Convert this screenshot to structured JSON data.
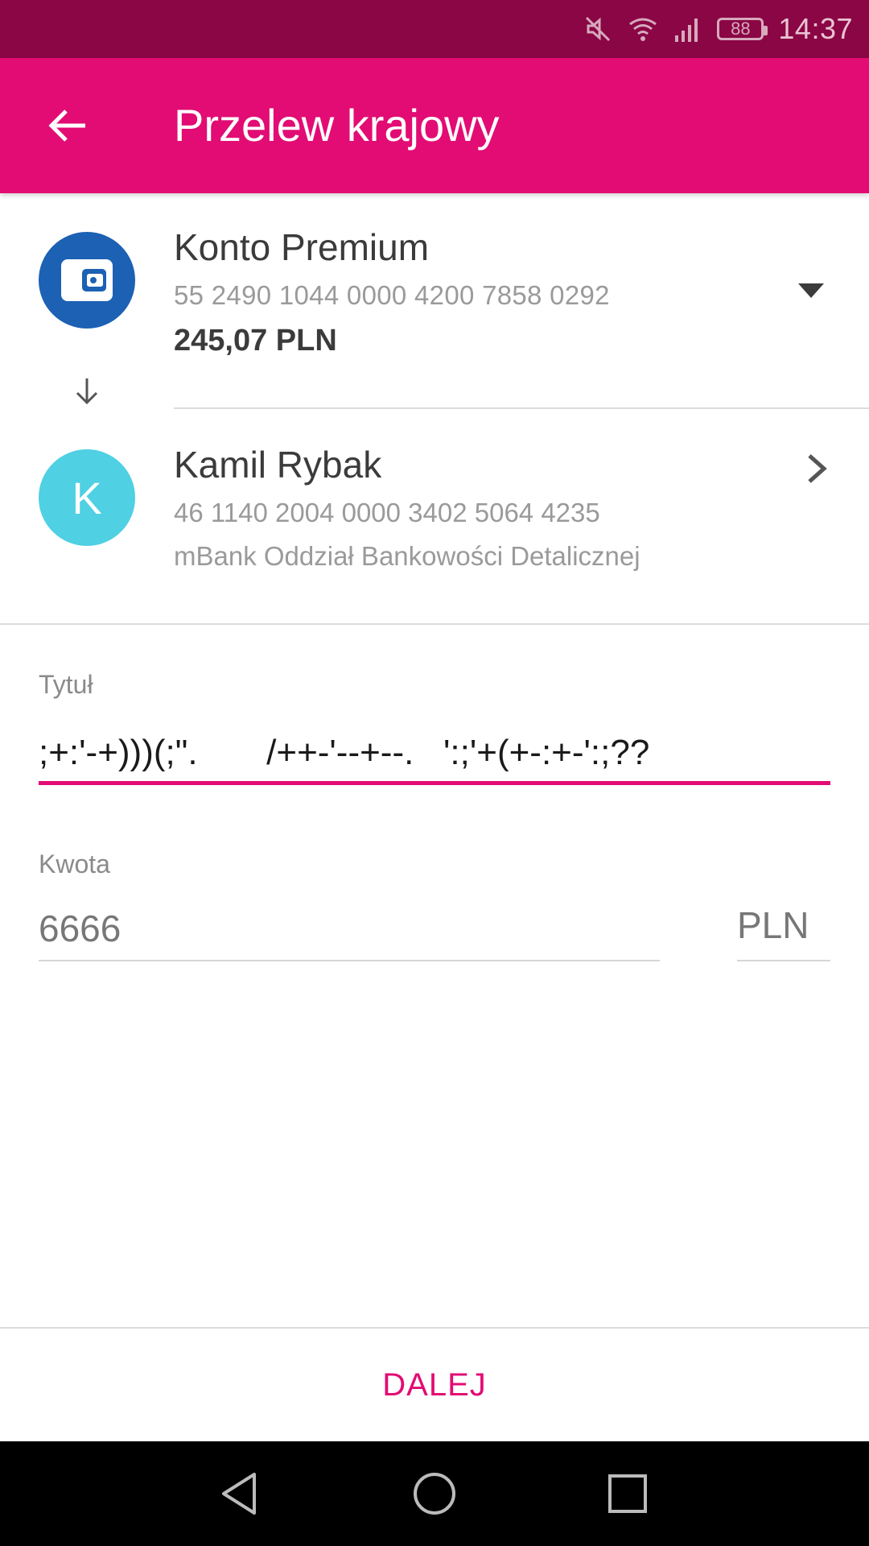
{
  "status_bar": {
    "time": "14:37",
    "battery": "88",
    "icons": [
      "mute-icon",
      "wifi-icon",
      "signal-icon",
      "battery-icon"
    ]
  },
  "app_bar": {
    "title": "Przelew krajowy",
    "back_icon": "arrow-left-icon"
  },
  "source_account": {
    "name": "Konto Premium",
    "number": "55 2490 1044 0000 4200 7858 0292",
    "balance": "245,07 PLN",
    "icon": "wallet-icon"
  },
  "recipient": {
    "initial": "K",
    "name": "Kamil Rybak",
    "number": "46 1140 2004 0000 3402 5064 4235",
    "bank": "mBank Oddział Bankowości Detalicznej"
  },
  "form": {
    "title_label": "Tytuł",
    "title_value": ";+:'-+)))(;\".       /++-'--+--.   ':;'+(+-:+-':;??",
    "amount_label": "Kwota",
    "amount_value": "6666",
    "currency": "PLN"
  },
  "footer": {
    "next_label": "DALEJ"
  },
  "colors": {
    "status_bar": "#8a0644",
    "primary": "#e20c74",
    "account_avatar": "#1c61b3",
    "recipient_avatar": "#4fd0e3"
  }
}
